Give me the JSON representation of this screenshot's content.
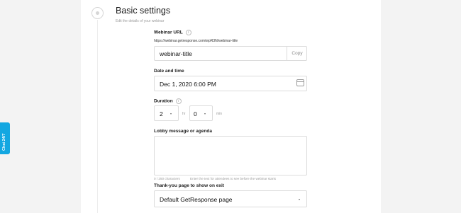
{
  "section": {
    "title": "Basic settings",
    "subtitle": "Edit the details of your webinar"
  },
  "webinar_url": {
    "label": "Webinar URL",
    "info": "i",
    "url": "https://webinar.getresponse.com/wpR3N/webinar-title",
    "slug_value": "webinar-title",
    "copy_label": "Copy"
  },
  "date_time": {
    "label": "Date and time",
    "value": "Dec 1, 2020 6:00 PM",
    "icon": "calendar-icon"
  },
  "duration": {
    "label": "Duration",
    "info": "i",
    "hours_value": "2",
    "hours_unit": "hr",
    "minutes_value": "0",
    "minutes_unit": "min",
    "caret": "▾"
  },
  "lobby": {
    "label": "Lobby message or agenda",
    "value": "",
    "char_count": "0 / 250 characters",
    "hint": "Enter the text for attendees to see before the webinar starts"
  },
  "thank_you": {
    "label": "Thank-you page to show on exit",
    "selected": "Default GetResponse page",
    "caret": "▾"
  },
  "chat_tab": {
    "label": "Chat 24/7",
    "color": "#13a7e1"
  },
  "colors": {
    "background": "#f3f3f3",
    "panel": "#ffffff",
    "border": "#dcdcdc"
  }
}
